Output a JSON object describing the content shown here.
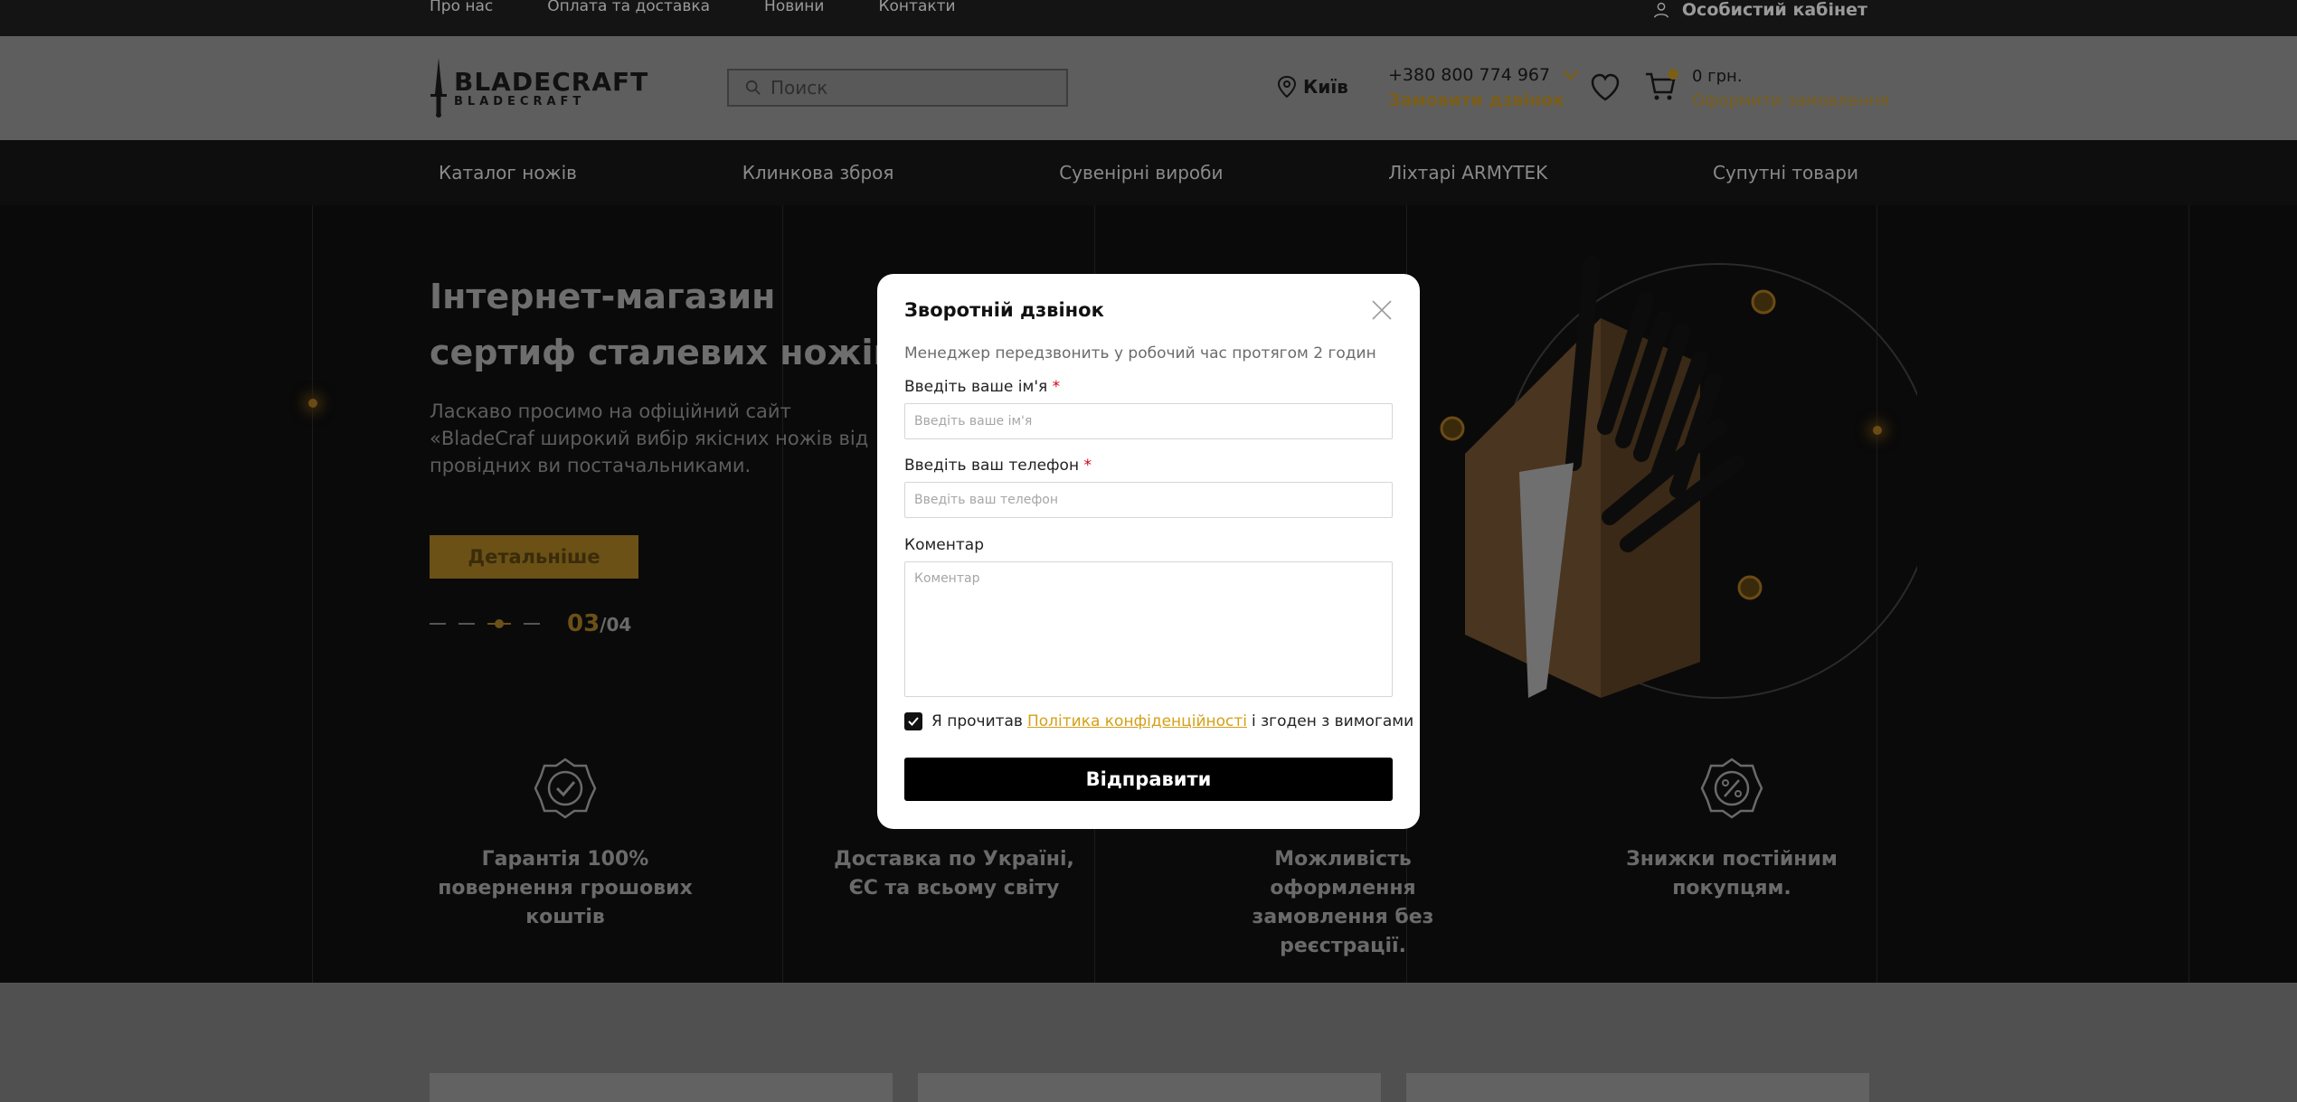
{
  "topbar": {
    "links": [
      "Про нас",
      "Оплата та доставка",
      "Новини",
      "Контакти"
    ],
    "cabinet": "Особистий кабінет"
  },
  "header": {
    "logo_big": "BLADECRAFT",
    "logo_small": "BLADECRAFT",
    "search_placeholder": "Поиск",
    "city": "Київ",
    "phone": "+380 800 774 967",
    "callback": "Замовити дзвінок",
    "cart_sum": "0 грн.",
    "cart_order": "Оформити замовлення"
  },
  "mainnav": [
    "Каталог ножів",
    "Клинкова зброя",
    "Сувенірні вироби",
    "Ліхтарі ARMYTEK",
    "Супутні товари"
  ],
  "hero": {
    "title": "Інтернет-магазин сертиф сталевих ножів",
    "description": "Ласкаво просимо на офіційний сайт «BladeCraf широкий вибір якісних ножів від провідних ви постачальниками.",
    "button": "Детальніше",
    "current_slide": "03",
    "total_slides": "/04"
  },
  "features": [
    {
      "text": "Гарантія 100% повернення грошових коштів",
      "icon": "check-badge-icon"
    },
    {
      "text": "Доставка по Україні, ЄС та всьому світу",
      "icon": "globe-icon"
    },
    {
      "text": "Можливість оформлення замовлення без реєстрації.",
      "icon": "document-icon"
    },
    {
      "text": "Знижки постійним покупцям.",
      "icon": "percent-badge-icon"
    }
  ],
  "modal": {
    "title": "Зворотній дзвінок",
    "subtitle": "Менеджер передзвонить у робочий час протягом 2 годин",
    "name_label": "Введіть ваше ім'я",
    "name_placeholder": "Введіть ваше ім'я",
    "phone_label": "Введіть ваш телефон",
    "phone_placeholder": "Введіть ваш телефон",
    "comment_label": "Коментар",
    "comment_placeholder": "Коментар",
    "required_mark": "*",
    "agree_before": "Я прочитав",
    "agree_link": "Політика конфіденційності",
    "agree_after": "і згоден з вимогами",
    "agree_checked": true,
    "submit": "Відправити"
  },
  "colors": {
    "accent": "#d4a017",
    "dark": "#0a0a0a",
    "required": "#d0021b"
  }
}
